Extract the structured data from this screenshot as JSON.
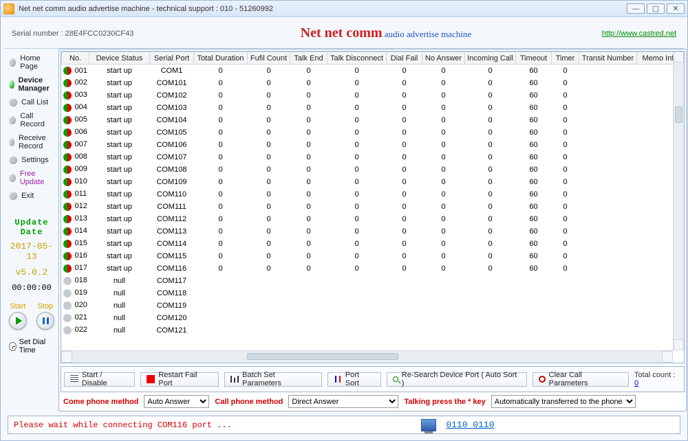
{
  "window_title": "Net net comm audio advertise machine - technical support : 010 - 51260992",
  "serial": "Serial number : 28E4FCC0230CF43",
  "product_bold": "Net net comm",
  "product_small": " audio advertise machine",
  "url": "http://www.castred.net",
  "nav": {
    "home": {
      "label": "Home Page"
    },
    "devmgr": {
      "label": "Device Manager"
    },
    "calllist": {
      "label": "Call List"
    },
    "callrec": {
      "label": "Call Record"
    },
    "recvrec": {
      "label": "Receive Record"
    },
    "settings": {
      "label": "Settings"
    },
    "freeupd": {
      "label": "Free Update"
    },
    "exit": {
      "label": "Exit"
    }
  },
  "side": {
    "update_label": "Update Date",
    "update_date": "2017-05-13",
    "version": "v5.0.2",
    "clock": "00:00:00",
    "start": "Start",
    "stop": "Stop",
    "dialtime": "Set Dial Time"
  },
  "columns": [
    "No.",
    "Device Status",
    "Serial Port",
    "Total Duration",
    "Fufil Count",
    "Talk End",
    "Talk Disconnect",
    "Dial Fail",
    "No Answer",
    "Incoming Call",
    "Timeout",
    "Timer",
    "Transit Number",
    "Memo Info"
  ],
  "rows": [
    {
      "no": "001",
      "status": "start up",
      "port": "COM1",
      "td": "0",
      "fc": "0",
      "te": "0",
      "tdc": "0",
      "df": "0",
      "na": "0",
      "ic": "0",
      "to": "60",
      "tm": "0"
    },
    {
      "no": "002",
      "status": "start up",
      "port": "COM101",
      "td": "0",
      "fc": "0",
      "te": "0",
      "tdc": "0",
      "df": "0",
      "na": "0",
      "ic": "0",
      "to": "60",
      "tm": "0"
    },
    {
      "no": "003",
      "status": "start up",
      "port": "COM102",
      "td": "0",
      "fc": "0",
      "te": "0",
      "tdc": "0",
      "df": "0",
      "na": "0",
      "ic": "0",
      "to": "60",
      "tm": "0"
    },
    {
      "no": "004",
      "status": "start up",
      "port": "COM103",
      "td": "0",
      "fc": "0",
      "te": "0",
      "tdc": "0",
      "df": "0",
      "na": "0",
      "ic": "0",
      "to": "60",
      "tm": "0"
    },
    {
      "no": "005",
      "status": "start up",
      "port": "COM104",
      "td": "0",
      "fc": "0",
      "te": "0",
      "tdc": "0",
      "df": "0",
      "na": "0",
      "ic": "0",
      "to": "60",
      "tm": "0"
    },
    {
      "no": "006",
      "status": "start up",
      "port": "COM105",
      "td": "0",
      "fc": "0",
      "te": "0",
      "tdc": "0",
      "df": "0",
      "na": "0",
      "ic": "0",
      "to": "60",
      "tm": "0"
    },
    {
      "no": "007",
      "status": "start up",
      "port": "COM106",
      "td": "0",
      "fc": "0",
      "te": "0",
      "tdc": "0",
      "df": "0",
      "na": "0",
      "ic": "0",
      "to": "60",
      "tm": "0"
    },
    {
      "no": "008",
      "status": "start up",
      "port": "COM107",
      "td": "0",
      "fc": "0",
      "te": "0",
      "tdc": "0",
      "df": "0",
      "na": "0",
      "ic": "0",
      "to": "60",
      "tm": "0"
    },
    {
      "no": "009",
      "status": "start up",
      "port": "COM108",
      "td": "0",
      "fc": "0",
      "te": "0",
      "tdc": "0",
      "df": "0",
      "na": "0",
      "ic": "0",
      "to": "60",
      "tm": "0"
    },
    {
      "no": "010",
      "status": "start up",
      "port": "COM109",
      "td": "0",
      "fc": "0",
      "te": "0",
      "tdc": "0",
      "df": "0",
      "na": "0",
      "ic": "0",
      "to": "60",
      "tm": "0"
    },
    {
      "no": "011",
      "status": "start up",
      "port": "COM110",
      "td": "0",
      "fc": "0",
      "te": "0",
      "tdc": "0",
      "df": "0",
      "na": "0",
      "ic": "0",
      "to": "60",
      "tm": "0"
    },
    {
      "no": "012",
      "status": "start up",
      "port": "COM111",
      "td": "0",
      "fc": "0",
      "te": "0",
      "tdc": "0",
      "df": "0",
      "na": "0",
      "ic": "0",
      "to": "60",
      "tm": "0"
    },
    {
      "no": "013",
      "status": "start up",
      "port": "COM112",
      "td": "0",
      "fc": "0",
      "te": "0",
      "tdc": "0",
      "df": "0",
      "na": "0",
      "ic": "0",
      "to": "60",
      "tm": "0"
    },
    {
      "no": "014",
      "status": "start up",
      "port": "COM113",
      "td": "0",
      "fc": "0",
      "te": "0",
      "tdc": "0",
      "df": "0",
      "na": "0",
      "ic": "0",
      "to": "60",
      "tm": "0"
    },
    {
      "no": "015",
      "status": "start up",
      "port": "COM114",
      "td": "0",
      "fc": "0",
      "te": "0",
      "tdc": "0",
      "df": "0",
      "na": "0",
      "ic": "0",
      "to": "60",
      "tm": "0"
    },
    {
      "no": "016",
      "status": "start up",
      "port": "COM115",
      "td": "0",
      "fc": "0",
      "te": "0",
      "tdc": "0",
      "df": "0",
      "na": "0",
      "ic": "0",
      "to": "60",
      "tm": "0"
    },
    {
      "no": "017",
      "status": "start up",
      "port": "COM116",
      "td": "0",
      "fc": "0",
      "te": "0",
      "tdc": "0",
      "df": "0",
      "na": "0",
      "ic": "0",
      "to": "60",
      "tm": "0"
    },
    {
      "no": "018",
      "status": "null",
      "port": "COM117",
      "td": "",
      "fc": "",
      "te": "",
      "tdc": "",
      "df": "",
      "na": "",
      "ic": "",
      "to": "",
      "tm": ""
    },
    {
      "no": "019",
      "status": "null",
      "port": "COM118",
      "td": "",
      "fc": "",
      "te": "",
      "tdc": "",
      "df": "",
      "na": "",
      "ic": "",
      "to": "",
      "tm": ""
    },
    {
      "no": "020",
      "status": "null",
      "port": "COM119",
      "td": "",
      "fc": "",
      "te": "",
      "tdc": "",
      "df": "",
      "na": "",
      "ic": "",
      "to": "",
      "tm": ""
    },
    {
      "no": "021",
      "status": "null",
      "port": "COM120",
      "td": "",
      "fc": "",
      "te": "",
      "tdc": "",
      "df": "",
      "na": "",
      "ic": "",
      "to": "",
      "tm": ""
    },
    {
      "no": "022",
      "status": "null",
      "port": "COM121",
      "td": "",
      "fc": "",
      "te": "",
      "tdc": "",
      "df": "",
      "na": "",
      "ic": "",
      "to": "",
      "tm": ""
    }
  ],
  "toolbar": {
    "start_disable": "Start / Disable",
    "restart": "Restart Fail Port",
    "batch": "Batch Set Parameters",
    "sort": "Port Sort",
    "research": "Re-Search Device Port ( Auto Sort )",
    "clear": "Clear Call Parameters",
    "total_label": "Total count :",
    "total_value": "0"
  },
  "method": {
    "come_label": "Come phone method",
    "come_value": "Auto Answer",
    "call_label": "Call phone method",
    "call_value": "Direct Answer",
    "star_label": "Talking press the * key",
    "star_value": "Automatically transferred to the phone"
  },
  "footer": {
    "status": "Please wait while connecting COM116 port ...",
    "binary": "0110 0110"
  }
}
